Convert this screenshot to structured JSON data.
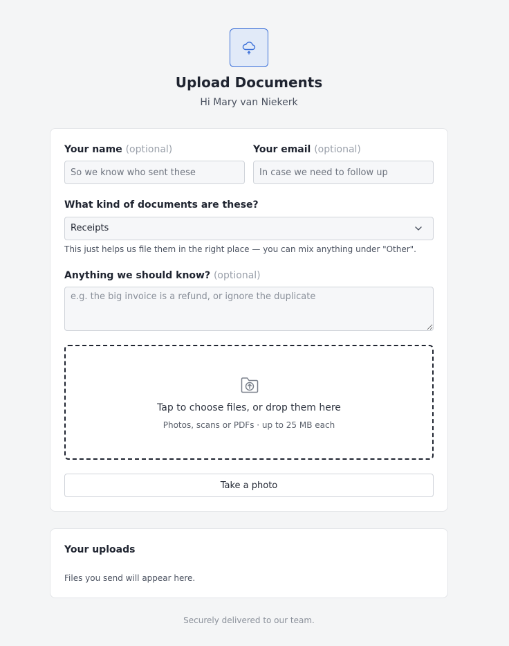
{
  "header": {
    "logo_icon": "cloud-upload-icon",
    "title": "Upload Documents",
    "greeting": "Hi Mary van Niekerk"
  },
  "form": {
    "name_label": "Your name",
    "name_optional": "(optional)",
    "name_placeholder": "So we know who sent these",
    "name_value": "",
    "email_label": "Your email",
    "email_optional": "(optional)",
    "email_placeholder": "In case we need to follow up",
    "email_value": "",
    "doc_type_label": "What kind of documents are these?",
    "doc_type_selected": "Receipts",
    "doc_type_help": "This just helps us file them in the right place — you can mix anything under \"Other\".",
    "notes_label": "Anything we should know?",
    "notes_optional": "(optional)",
    "notes_placeholder": "e.g. the big invoice is a refund, or ignore the duplicate",
    "notes_value": ""
  },
  "dropzone": {
    "icon": "folder-upload-icon",
    "title": "Tap to choose files, or drop them here",
    "subtitle": "Photos, scans or PDFs · up to 25 MB each"
  },
  "actions": {
    "take_photo_label": "Take a photo"
  },
  "uploads": {
    "title": "Your uploads",
    "empty_text": "Files you send will appear here."
  },
  "footer": {
    "text": "Securely delivered to our team."
  },
  "colors": {
    "accent": "#3a6fd8",
    "accent_bg": "#e1eaf8",
    "background": "#f4f5f6",
    "card": "#ffffff"
  }
}
